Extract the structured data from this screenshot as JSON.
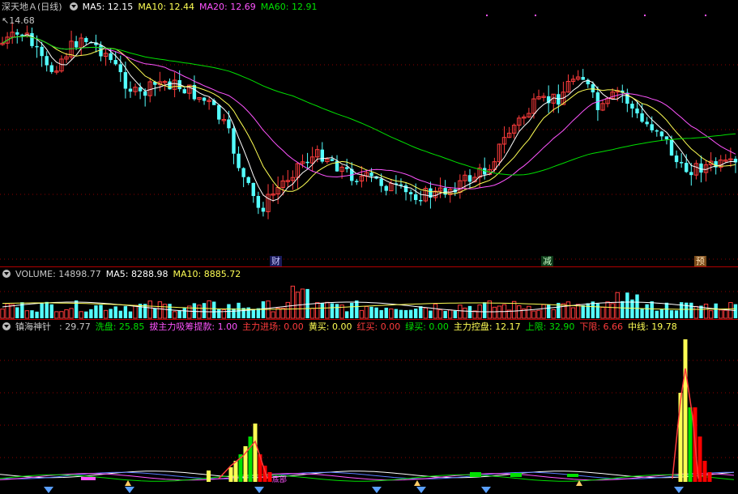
{
  "main_header": {
    "title": "深天地Ａ(日线)",
    "ma5": "MA5: 12.15",
    "ma10": "MA10: 12.44",
    "ma20": "MA20: 12.69",
    "ma60": "MA60: 12.91"
  },
  "main_chart": {
    "high_label": "14.68",
    "events": [
      "财",
      "减",
      "预"
    ]
  },
  "volume_header": {
    "title": "VOLUME: 14898.77",
    "ma5": "MA5: 8288.98",
    "ma10": "MA10: 8885.72"
  },
  "indicator_header": {
    "name": "镇海神针",
    "value": ": 29.77",
    "xipan": "洗盘: 25.85",
    "xicheng": "拔主力吸筹提款: 1.00",
    "zhuli_jinchang": "主力进场: 0.00",
    "huangmai": "黄买: 0.00",
    "hongmai": "红买: 0.00",
    "lvmai": "绿买: 0.00",
    "kongpan": "主力控盘: 12.17",
    "shangxian": "上限: 32.90",
    "xiaxian": "下限: 6.66",
    "zhongxian": "中线: 19.78",
    "bottom_tag": "底部"
  },
  "colors": {
    "up": "#ff3c3c",
    "down": "#54ffff",
    "ma5": "#ffffff",
    "ma10": "#ffff54",
    "ma20": "#ff54ff",
    "ma60": "#00e000",
    "grid": "#8b0000",
    "header_gray": "#c8c8c8"
  }
}
